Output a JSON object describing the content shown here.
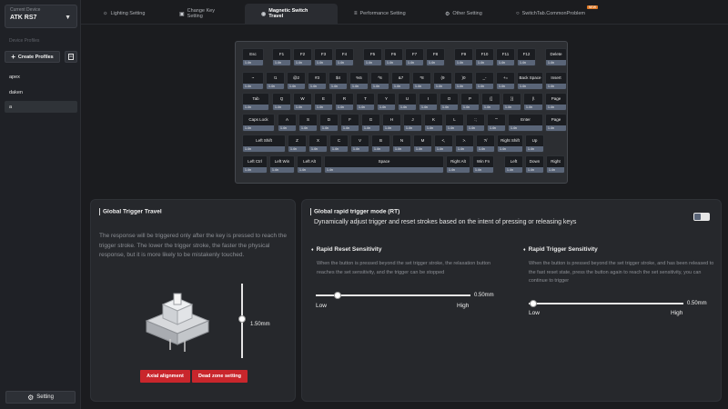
{
  "sidebar": {
    "device_label": "Current Device",
    "device_name": "ATK RS7",
    "profiles_label": "Device Profiles",
    "create_label": "Create Profiles",
    "profiles": [
      "apex",
      "daken",
      "a"
    ],
    "setting_label": "Setting"
  },
  "tabs": [
    {
      "label": "Lighting Setting",
      "icon": "sun-icon"
    },
    {
      "label": "Change Key Setting",
      "icon": "keyboard-icon"
    },
    {
      "label": "Magnetic Switch Travel",
      "icon": "target-icon"
    },
    {
      "label": "Performance Setting",
      "icon": "sliders-icon"
    },
    {
      "label": "Other Setting",
      "icon": "gear-icon"
    },
    {
      "label": "SwitchTab.CommonProblem",
      "icon": "help-icon",
      "badge": "NEW"
    }
  ],
  "keyboard": {
    "value": "1.4n",
    "keys": [
      "Esc",
      "F1",
      "F2",
      "F3",
      "F4",
      "F5",
      "F6",
      "F7",
      "F8",
      "F9",
      "F10",
      "F11",
      "F12",
      "Delete",
      "~",
      "!1",
      "@2",
      "#3",
      "$4",
      "%5",
      "^6",
      "&7",
      "*8",
      "(9",
      ")0",
      "_-",
      "+=",
      "Back Space",
      "Insert",
      "Tab",
      "Q",
      "W",
      "E",
      "R",
      "T",
      "Y",
      "U",
      "I",
      "O",
      "P",
      "{[",
      "}]",
      "|\\",
      "Page",
      "Caps Lock",
      "A",
      "S",
      "D",
      "F",
      "G",
      "H",
      "J",
      "K",
      "L",
      ":;",
      "\"'",
      "Enter",
      "Page",
      "Left Shift",
      "Z",
      "X",
      "C",
      "V",
      "B",
      "N",
      "M",
      "<,",
      ">.",
      "?/",
      "Right Shift",
      "Up",
      "Left Ctrl",
      "Left Win",
      "Left Alt",
      "Space",
      "Right Alt",
      "Win Fn",
      "Left",
      "Down",
      "Right"
    ]
  },
  "global_travel": {
    "title": "Global Trigger Travel",
    "description": "The response will be triggered only after the key is pressed to reach the trigger stroke. The lower the trigger stroke, the faster the physical response, but it is more likely to be mistakenly touched.",
    "value": "1.50mm",
    "position": 0.47,
    "axial_btn": "Axial alignment",
    "deadzone_btn": "Dead zone setting"
  },
  "rapid_trigger": {
    "title": "Global rapid trigger mode (RT)",
    "subtitle": "Dynamically adjust trigger and reset strokes based on the intent of pressing or releasing keys",
    "toggle_on": true,
    "reset": {
      "title": "Rapid Reset Sensitivity",
      "description": "When the button is pressed beyond the set trigger stroke, the relaxation button reaches the set sensitivity, and the trigger can be stopped",
      "value": "0.50mm",
      "position": 0.14,
      "low": "Low",
      "high": "High"
    },
    "trigger": {
      "title": "Rapid Trigger Sensitivity",
      "description": "When the button is pressed beyond the set trigger stroke, and has been released to the fast reset state, press the button again to reach the set sensitivity, you can continue to trigger",
      "value": "0.50mm",
      "position": 0.03,
      "low": "Low",
      "high": "High"
    }
  },
  "colors": {
    "accent_red": "#c9262c",
    "key_value_strip": "#5a6578",
    "badge_orange": "#e07a27"
  }
}
